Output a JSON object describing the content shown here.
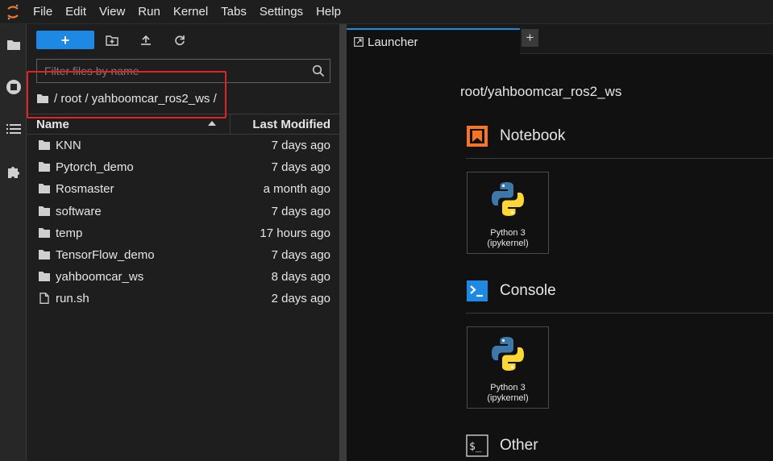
{
  "menubar": {
    "items": [
      "File",
      "Edit",
      "View",
      "Run",
      "Kernel",
      "Tabs",
      "Settings",
      "Help"
    ]
  },
  "filebrowser": {
    "new_label": "+",
    "filter_placeholder": "Filter files by name",
    "breadcrumb": "/ root / yahboomcar_ros2_ws /",
    "columns": {
      "name": "Name",
      "modified": "Last Modified"
    },
    "files": [
      {
        "name": "KNN",
        "modified": "7 days ago",
        "type": "folder"
      },
      {
        "name": "Pytorch_demo",
        "modified": "7 days ago",
        "type": "folder"
      },
      {
        "name": "Rosmaster",
        "modified": "a month ago",
        "type": "folder"
      },
      {
        "name": "software",
        "modified": "7 days ago",
        "type": "folder"
      },
      {
        "name": "temp",
        "modified": "17 hours ago",
        "type": "folder"
      },
      {
        "name": "TensorFlow_demo",
        "modified": "7 days ago",
        "type": "folder"
      },
      {
        "name": "yahboomcar_ws",
        "modified": "8 days ago",
        "type": "folder"
      },
      {
        "name": "run.sh",
        "modified": "2 days ago",
        "type": "file"
      }
    ]
  },
  "main": {
    "tab_label": "Launcher",
    "add_tab": "+",
    "path": "root/yahboomcar_ros2_ws",
    "sections": {
      "notebook": {
        "title": "Notebook",
        "card": {
          "line1": "Python 3",
          "line2": "(ipykernel)"
        }
      },
      "console": {
        "title": "Console",
        "card": {
          "line1": "Python 3",
          "line2": "(ipykernel)"
        }
      },
      "other": {
        "title": "Other"
      }
    }
  },
  "colors": {
    "accent": "#1e88e5",
    "highlight": "#e02424",
    "notebook_icon": "#f37726",
    "console_icon": "#1e88e5"
  }
}
